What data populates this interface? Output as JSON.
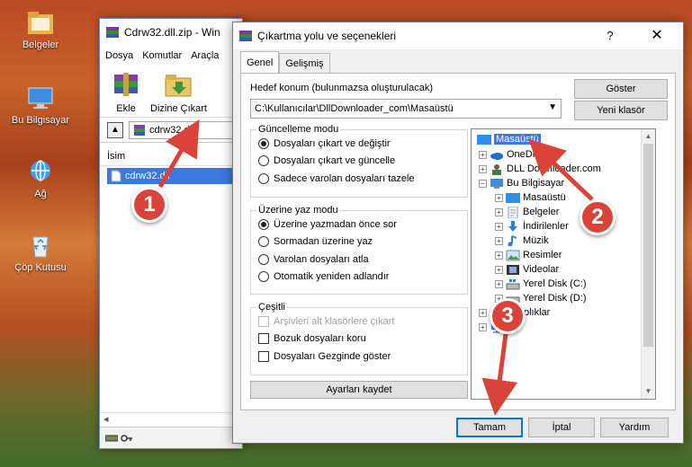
{
  "desktop": {
    "icons": [
      {
        "label": "Belgeler"
      },
      {
        "label": "Bu Bilgisayar"
      },
      {
        "label": "Ağ"
      },
      {
        "label": "Çöp Kutusu"
      }
    ]
  },
  "winrar": {
    "title": "Cdrw32.dll.zip - Win",
    "menu": [
      "Dosya",
      "Komutlar",
      "Araçla"
    ],
    "toolbar": [
      {
        "label": "Ekle"
      },
      {
        "label": "Dizine Çıkart"
      }
    ],
    "path": "cdrw32.dll.",
    "column_header": "İsim",
    "file": "cdrw32.dll"
  },
  "dialog": {
    "title": "Çıkartma yolu ve seçenekleri",
    "help": "?",
    "close": "✕",
    "tabs": [
      {
        "label": "Genel",
        "active": true
      },
      {
        "label": "Gelişmiş",
        "active": false
      }
    ],
    "destination_label": "Hedef konum (bulunmazsa oluşturulacak)",
    "destination_value": "C:\\Kullanıcılar\\DllDownloader_com\\Masaüstü",
    "show_button": "Göster",
    "new_folder_button": "Yeni klasör",
    "update_mode": {
      "title": "Güncelleme modu",
      "options": [
        {
          "label": "Dosyaları çıkart ve değiştir",
          "selected": true
        },
        {
          "label": "Dosyaları çıkart ve güncelle",
          "selected": false
        },
        {
          "label": "Sadece varolan dosyaları tazele",
          "selected": false
        }
      ]
    },
    "overwrite_mode": {
      "title": "Üzerine yaz modu",
      "options": [
        {
          "label": "Üzerine yazmadan önce sor",
          "selected": true
        },
        {
          "label": "Sormadan üzerine yaz",
          "selected": false
        },
        {
          "label": "Varolan dosyaları atla",
          "selected": false
        },
        {
          "label": "Otomatik yeniden adlandır",
          "selected": false
        }
      ]
    },
    "misc": {
      "title": "Çeşitli",
      "options": [
        {
          "label": "Arşivleri alt klasörlere çıkart",
          "checked": false,
          "disabled": true
        },
        {
          "label": "Bozuk dosyaları koru",
          "checked": false,
          "disabled": false
        },
        {
          "label": "Dosyaları Gezginde göster",
          "checked": false,
          "disabled": false
        }
      ]
    },
    "save_settings_button": "Ayarları kaydet",
    "tree": [
      {
        "label": "Masaüstü",
        "selected": true,
        "expander": ""
      },
      {
        "label": "OneDrive",
        "selected": false,
        "expander": "+"
      },
      {
        "label": "DLL Downloader.com",
        "selected": false,
        "expander": "+"
      },
      {
        "label": "Bu Bilgisayar",
        "selected": false,
        "expander": "−"
      },
      {
        "label": "Masaüstü",
        "selected": false,
        "expander": "+"
      },
      {
        "label": "Belgeler",
        "selected": false,
        "expander": "+"
      },
      {
        "label": "İndirilenler",
        "selected": false,
        "expander": "+"
      },
      {
        "label": "Müzik",
        "selected": false,
        "expander": "+"
      },
      {
        "label": "Resimler",
        "selected": false,
        "expander": "+"
      },
      {
        "label": "Videolar",
        "selected": false,
        "expander": "+"
      },
      {
        "label": "Yerel Disk (C:)",
        "selected": false,
        "expander": "+"
      },
      {
        "label": "Yerel Disk (D:)",
        "selected": false,
        "expander": "+"
      },
      {
        "label": "Kitaplıklar",
        "selected": false,
        "expander": "+"
      },
      {
        "label": "Ağ",
        "selected": false,
        "expander": "+"
      }
    ],
    "ok_button": "Tamam",
    "cancel_button": "İptal",
    "help_button": "Yardım"
  },
  "callouts": [
    {
      "number": "1"
    },
    {
      "number": "2"
    },
    {
      "number": "3"
    }
  ],
  "colors": {
    "accent": "#3b78e0",
    "callout": "#d9433a",
    "arrow": "#d9433a"
  }
}
